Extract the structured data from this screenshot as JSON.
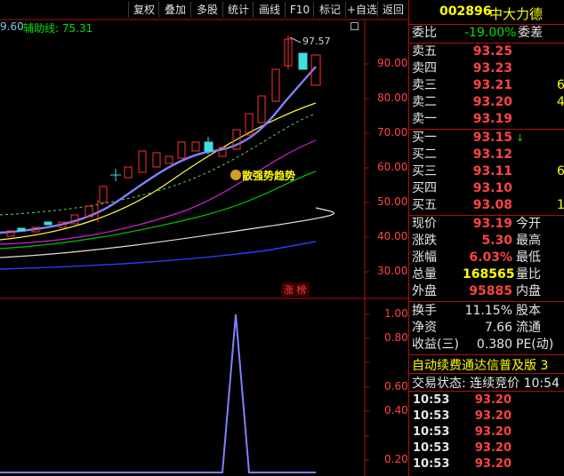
{
  "toolbar": {
    "items": [
      "复权",
      "叠加",
      "多股",
      "统计",
      "画线",
      "F10",
      "标记",
      "+自选",
      "返回"
    ]
  },
  "indicator_bar": {
    "left_value": "9.60",
    "aux_label": "辅助线: 75.31"
  },
  "chart": {
    "price_axis": [
      "90.00",
      "80.00",
      "70.00",
      "60.00",
      "50.00",
      "40.00",
      "30.00"
    ],
    "high_label": "97.57",
    "signal_label": "散强势趋势",
    "badge": "涨 榜"
  },
  "sub_chart": {
    "axis": [
      "1.00",
      "0.80",
      "0.60",
      "0.40",
      "0.20"
    ]
  },
  "chart_data": {
    "type": "line",
    "xlabel": "",
    "ylabel": "",
    "ylim": [
      0,
      1.1
    ],
    "x": [
      0,
      1,
      2,
      3,
      4,
      5,
      6,
      7,
      8,
      9,
      10,
      11,
      12,
      13,
      14,
      15,
      16,
      17,
      18,
      19,
      20
    ],
    "values": [
      0,
      0,
      0,
      0,
      0,
      0,
      0,
      0,
      0,
      0,
      0,
      0,
      0,
      0,
      0,
      1,
      0,
      0,
      0,
      0,
      0
    ]
  },
  "stock": {
    "code": "002896",
    "name": "中大力德"
  },
  "weibi": {
    "label": "委比",
    "value": "-19.00%",
    "label2": "委差"
  },
  "asks": [
    {
      "label": "卖五",
      "price": "93.25",
      "vol": ""
    },
    {
      "label": "卖四",
      "price": "93.23",
      "vol": ""
    },
    {
      "label": "卖三",
      "price": "93.21",
      "vol": "6"
    },
    {
      "label": "卖二",
      "price": "93.20",
      "vol": "4"
    },
    {
      "label": "卖一",
      "price": "93.19",
      "vol": ""
    }
  ],
  "bids": [
    {
      "label": "买一",
      "price": "93.15",
      "vol": ""
    },
    {
      "label": "买二",
      "price": "93.12",
      "vol": ""
    },
    {
      "label": "买三",
      "price": "93.11",
      "vol": "6"
    },
    {
      "label": "买四",
      "price": "93.10",
      "vol": ""
    },
    {
      "label": "买五",
      "price": "93.08",
      "vol": "1"
    }
  ],
  "quote": [
    {
      "label": "现价",
      "value": "93.19",
      "label2": "今开"
    },
    {
      "label": "涨跌",
      "value": "5.30",
      "label2": "最高"
    },
    {
      "label": "涨幅",
      "value": "6.03%",
      "label2": "最低"
    },
    {
      "label": "总量",
      "value": "168565",
      "label2": "量比"
    },
    {
      "label": "外盘",
      "value": "95885",
      "label2": "内盘"
    }
  ],
  "fin": [
    {
      "label": "换手",
      "value": "11.15%",
      "label2": "股本"
    },
    {
      "label": "净资",
      "value": "7.66",
      "label2": "流通"
    },
    {
      "label": "收益(三)",
      "value": "0.380",
      "label2": "PE(动)"
    }
  ],
  "promo": "自动续费通达信普及版 3",
  "trade_status": "交易状态: 连续竞价 10:54",
  "ticks": [
    {
      "time": "10:53",
      "price": "93.20"
    },
    {
      "time": "10:53",
      "price": "93.20"
    },
    {
      "time": "10:53",
      "price": "93.20"
    },
    {
      "time": "10:53",
      "price": "93.20"
    },
    {
      "time": "10:53",
      "price": "93.20"
    },
    {
      "time": "10:53",
      "price": "93.20"
    }
  ]
}
